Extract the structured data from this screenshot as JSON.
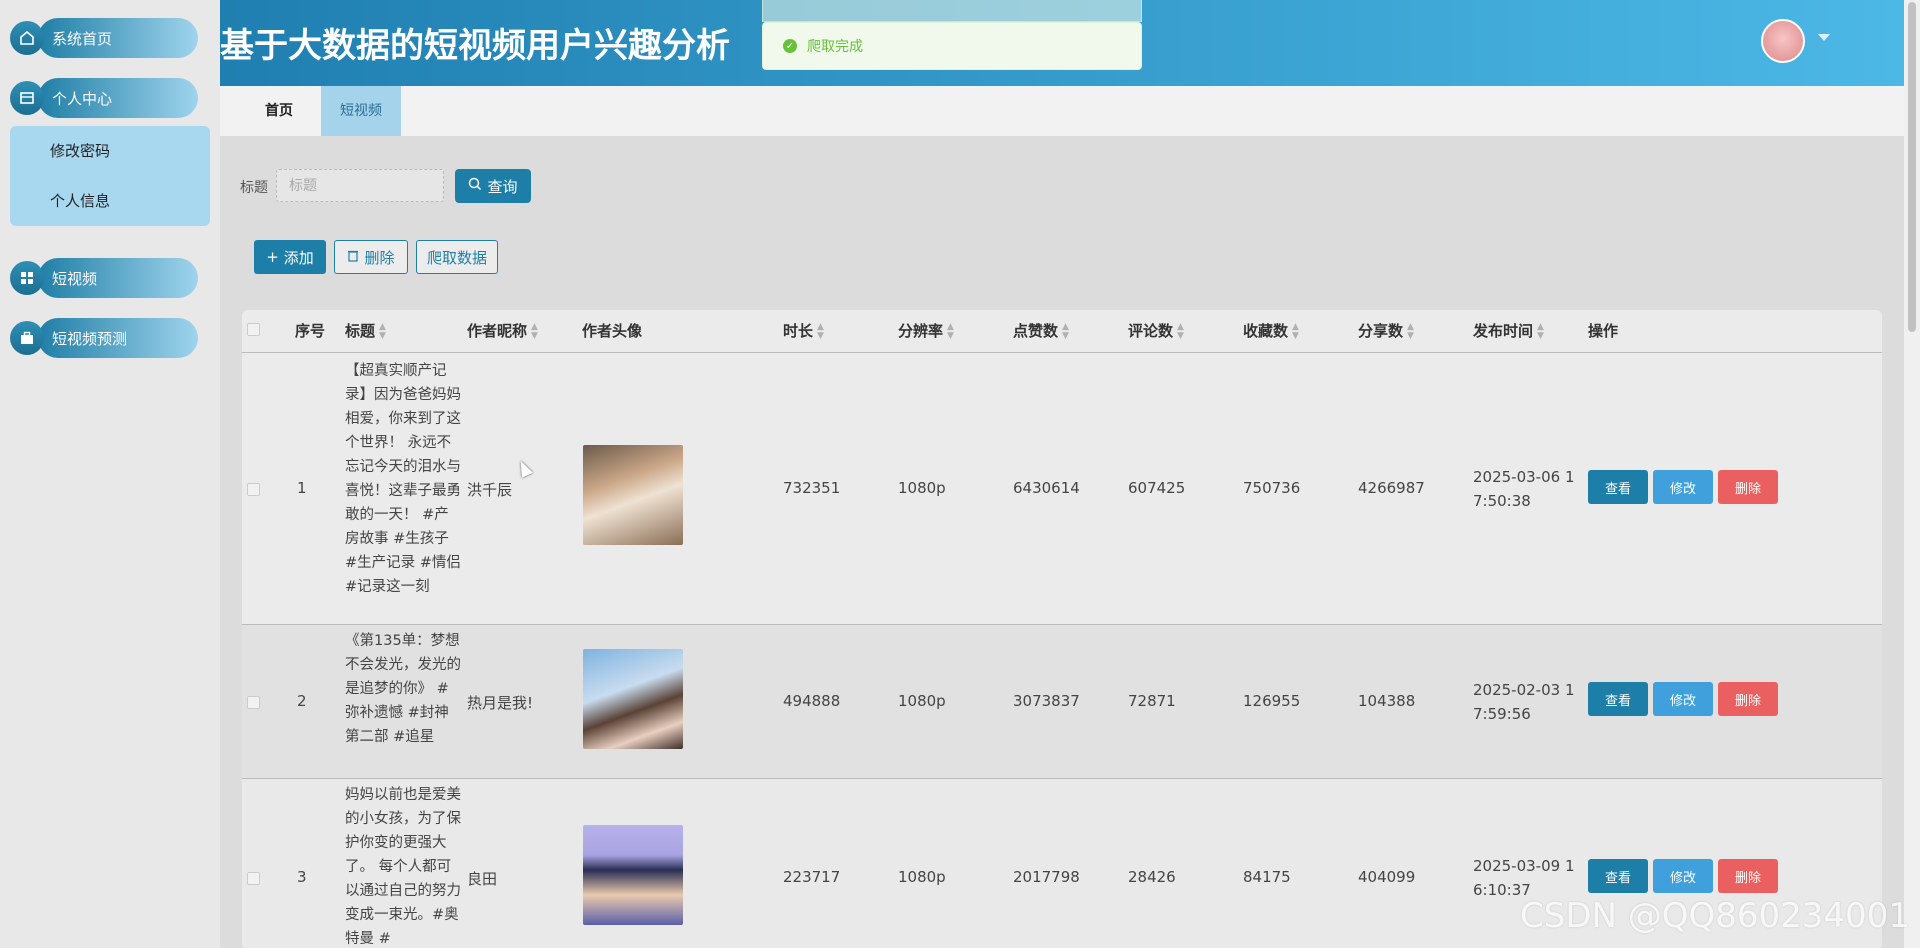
{
  "sidebar": {
    "items": [
      {
        "label": "系统首页",
        "icon": "home-icon"
      },
      {
        "label": "个人中心",
        "icon": "card-icon"
      },
      {
        "label": "短视频",
        "icon": "grid-icon"
      },
      {
        "label": "短视频预测",
        "icon": "briefcase-icon"
      }
    ],
    "submenu": [
      "修改密码",
      "个人信息"
    ]
  },
  "header": {
    "title": "基于大数据的短视频用户兴趣分析",
    "accent_color": "#1f7fb0"
  },
  "toast": {
    "text": "爬取完成",
    "icon": "check-circle-icon",
    "color": "#67c23a"
  },
  "tabs": [
    {
      "label": "首页",
      "active": false
    },
    {
      "label": "短视频",
      "active": true
    }
  ],
  "search": {
    "label": "标题",
    "placeholder": "标题",
    "value": "",
    "button": "查询"
  },
  "actions": {
    "add": "添加",
    "delete": "删除",
    "crawl": "爬取数据"
  },
  "table": {
    "columns": [
      "序号",
      "标题",
      "作者昵称",
      "作者头像",
      "时长",
      "分辨率",
      "点赞数",
      "评论数",
      "收藏数",
      "分享数",
      "发布时间",
      "操作"
    ],
    "rows": [
      {
        "index": "1",
        "title": "【超真实顺产记录】因为爸爸妈妈相爱，你来到了这个世界！ 永远不忘记今天的泪水与喜悦！这辈子最勇敢的一天！ #产房故事 #生孩子 #生产记录 #情侣 #记录这一刻",
        "author": "洪千辰",
        "duration": "732351",
        "resolution": "1080p",
        "likes": "6430614",
        "comments": "607425",
        "favorites": "750736",
        "shares": "4266987",
        "publish_time": "2025-03-06 17:50:38"
      },
      {
        "index": "2",
        "title": "《第135单：梦想不会发光，发光的是追梦的你》 #弥补遗憾 #封神第二部 #追星",
        "author": "热月是我!",
        "duration": "494888",
        "resolution": "1080p",
        "likes": "3073837",
        "comments": "72871",
        "favorites": "126955",
        "shares": "104388",
        "publish_time": "2025-02-03 17:59:56"
      },
      {
        "index": "3",
        "title": "妈妈以前也是爱美的小女孩，为了保护你变的更强大了。 每个人都可以通过自己的努力变成一束光。#奥特曼 #",
        "author": "良田",
        "duration": "223717",
        "resolution": "1080p",
        "likes": "2017798",
        "comments": "28426",
        "favorites": "84175",
        "shares": "404099",
        "publish_time": "2025-03-09 16:10:37"
      }
    ],
    "row_actions": {
      "view": "查看",
      "edit": "修改",
      "delete": "删除"
    }
  },
  "watermark": "CSDN @QQ860234001"
}
